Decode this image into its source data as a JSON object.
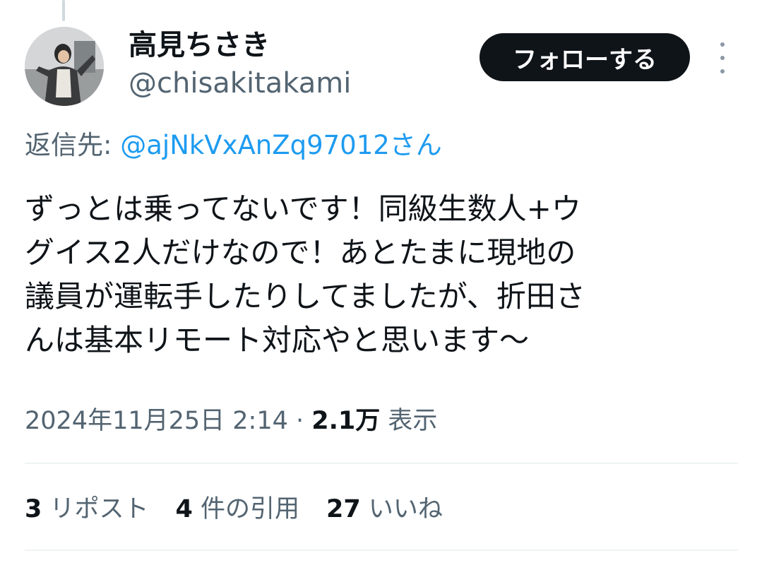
{
  "user": {
    "display_name": "高見ちさき",
    "handle": "@chisakitakami"
  },
  "header": {
    "follow_label": "フォローする",
    "more_icon": "more-vertical-icon"
  },
  "reply": {
    "prefix": "返信先: ",
    "handle": "@ajNkVxAnZq97012さん"
  },
  "tweet": {
    "lines": [
      "ずっとは乗ってないです！同級生数人+ウ",
      "グイス2人だけなので！あとたまに現地の",
      "議員が運転手したりしてましたが、折田さ",
      "んは基本リモート対応やと思います〜"
    ]
  },
  "meta": {
    "timestamp": "2024年11月25日 2:14",
    "separator": " · ",
    "views_count": "2.1万",
    "views_label": " 表示"
  },
  "stats": {
    "reposts_count": "3",
    "reposts_label": " リポスト",
    "quotes_count": "4",
    "quotes_label": " 件の引用",
    "likes_count": "27",
    "likes_label": " いいね"
  },
  "colors": {
    "text_primary": "#0f1419",
    "text_secondary": "#536471",
    "link": "#1d9bf0",
    "follow_button_bg": "#0f1419",
    "divider": "#eff3f4"
  }
}
